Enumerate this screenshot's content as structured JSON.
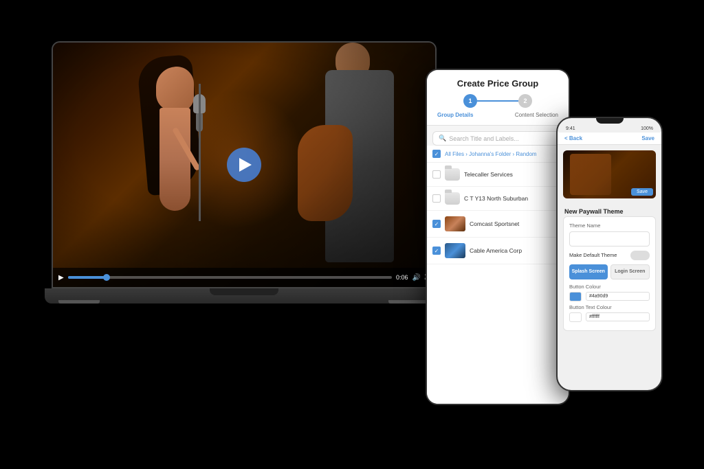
{
  "scene": {
    "background": "#000000"
  },
  "laptop": {
    "video": {
      "alt": "Singer performing with microphone and guitarist on stage",
      "time_current": "0:06",
      "time_total": "0:06",
      "progress_percent": 12
    },
    "controls": {
      "play_label": "▶",
      "time": "0:06",
      "volume_label": "🔊",
      "fullscreen_label": "⛶"
    }
  },
  "tablet": {
    "title": "Create Price Group",
    "steps": [
      {
        "number": "1",
        "label": "Group Details",
        "active": false
      },
      {
        "number": "2",
        "label": "Content Selection",
        "active": true
      }
    ],
    "search_placeholder": "Search Title and Labels...",
    "breadcrumb": "All Files › Johanna's Folder › Random",
    "list_items": [
      {
        "checked": false,
        "type": "folder",
        "name": "Telecaller Services"
      },
      {
        "checked": false,
        "type": "folder",
        "name": "C T Y13 North Suburban"
      },
      {
        "checked": true,
        "type": "video",
        "name": "Comcast Sportsnet"
      },
      {
        "checked": true,
        "type": "video",
        "name": "Cable America Corp"
      }
    ]
  },
  "phone": {
    "status_bar": {
      "time": "9:41",
      "signal": "●●●",
      "battery": "100%"
    },
    "header": {
      "back_label": "< Back",
      "title": "",
      "save_label": "Save"
    },
    "video_thumbnail": {
      "alt": "Singer performing"
    },
    "save_button_label": "Save",
    "section_title": "New Paywall Theme",
    "form": {
      "theme_name_label": "Theme Name",
      "theme_name_value": "",
      "theme_name_placeholder": "",
      "default_toggle_label": "Make Default Theme",
      "splash_screen_label": "Splash Screen",
      "login_screen_label": "Login Screen",
      "button_colour_label": "Button Colour",
      "button_colour_swatch": "#4a90d9",
      "button_text_colour_label": "Button Text Colour",
      "button_text_colour_value": "#ffffff"
    }
  }
}
